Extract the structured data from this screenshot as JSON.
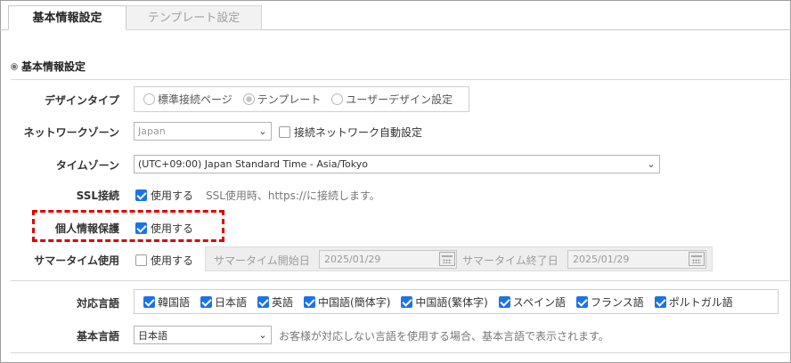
{
  "tabs": [
    {
      "label": "基本情報設定",
      "active": true
    },
    {
      "label": "テンプレート設定",
      "active": false
    }
  ],
  "section": {
    "title": "基本情報設定"
  },
  "design_type": {
    "label": "デザインタイプ",
    "options": [
      "標準接続ページ",
      "テンプレート",
      "ユーザーデザイン設定"
    ],
    "selected": "テンプレート"
  },
  "network_zone": {
    "label": "ネットワークゾーン",
    "value": "Japan",
    "auto_label": "接続ネットワーク自動設定",
    "auto_checked": false
  },
  "timezone": {
    "label": "タイムゾーン",
    "value": "(UTC+09:00) Japan Standard Time - Asia/Tokyo"
  },
  "ssl": {
    "label": "SSL接続",
    "checkbox_label": "使用する",
    "checked": true,
    "note": "SSL使用時、https://に接続します。"
  },
  "privacy": {
    "label": "個人情報保護",
    "checkbox_label": "使用する",
    "checked": true
  },
  "summer_time": {
    "label": "サマータイム使用",
    "checkbox_label": "使用する",
    "checked": false,
    "start_label": "サマータイム開始日",
    "start_date": "2025/01/29",
    "end_label": "サマータイム終了日",
    "end_date": "2025/01/29"
  },
  "languages": {
    "label": "対応言語",
    "items": [
      {
        "name": "韓国語",
        "checked": true
      },
      {
        "name": "日本語",
        "checked": true
      },
      {
        "name": "英語",
        "checked": true
      },
      {
        "name": "中国語(簡体字)",
        "checked": true
      },
      {
        "name": "中国語(繁体字)",
        "checked": true
      },
      {
        "name": "スペイン語",
        "checked": true
      },
      {
        "name": "フランス語",
        "checked": true
      },
      {
        "name": "ポルトガル語",
        "checked": true
      }
    ]
  },
  "base_language": {
    "label": "基本言語",
    "value": "日本語",
    "note": "お客様が対応しない言語を使用する場合、基本言語で表示されます。"
  },
  "colors": {
    "checkbox_blue": "#1a73e8",
    "highlight_red": "#e00000"
  }
}
